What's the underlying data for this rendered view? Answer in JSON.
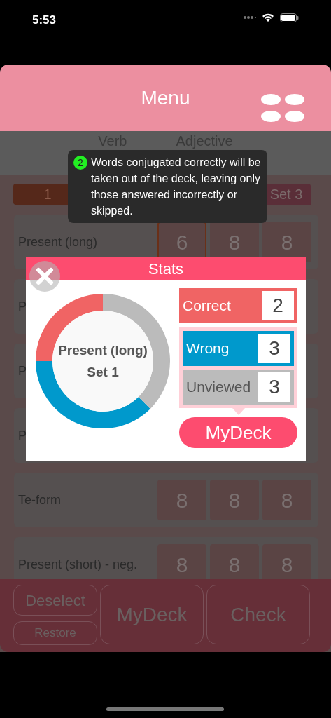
{
  "status_bar": {
    "time": "5:53"
  },
  "header": {
    "title": "Menu"
  },
  "tabs": [
    {
      "label": "Verb"
    },
    {
      "label": "Adjective"
    }
  ],
  "columns": [
    "1",
    "Set 3"
  ],
  "rows": [
    {
      "label": "Present (long)",
      "counts": [
        {
          "value": "6",
          "selected": true
        },
        {
          "value": "8",
          "selected": false
        },
        {
          "value": "8",
          "selected": false
        }
      ]
    },
    {
      "label": "P"
    },
    {
      "label": "P"
    },
    {
      "label": "P"
    },
    {
      "label": "Te-form",
      "counts": [
        {
          "value": "8",
          "selected": false
        },
        {
          "value": "8",
          "selected": false
        },
        {
          "value": "8",
          "selected": false
        }
      ]
    },
    {
      "label": "Present (short) - neg.",
      "counts": [
        {
          "value": "8",
          "selected": false
        },
        {
          "value": "8",
          "selected": false
        },
        {
          "value": "8",
          "selected": false
        }
      ]
    }
  ],
  "bottom_buttons": [
    {
      "label": "Deselect",
      "kind": "small"
    },
    {
      "label": "Restore",
      "kind": "small"
    },
    {
      "label": "MyDeck",
      "kind": "large"
    },
    {
      "label": "Check",
      "kind": "large"
    }
  ],
  "tooltip": {
    "badge": "2",
    "text": "Words conjugated correctly will be taken out of the deck, leaving only those answered incorrectly or skipped."
  },
  "stats_dialog": {
    "title": "Stats",
    "center_label": [
      "Present (long)",
      "Set 1"
    ],
    "chart_data": {
      "type": "donut",
      "values": [
        25,
        37.5,
        37.5
      ]
    },
    "items": [
      {
        "label": "Correct",
        "value": "2",
        "color": "#f06464",
        "in_deck": false
      },
      {
        "label": "Wrong",
        "value": "3",
        "color": "#0099cc",
        "in_deck": true
      },
      {
        "label": "Unviewed",
        "value": "3",
        "color": "#bbbbbb",
        "in_deck": true
      }
    ],
    "button": "MyDeck"
  }
}
